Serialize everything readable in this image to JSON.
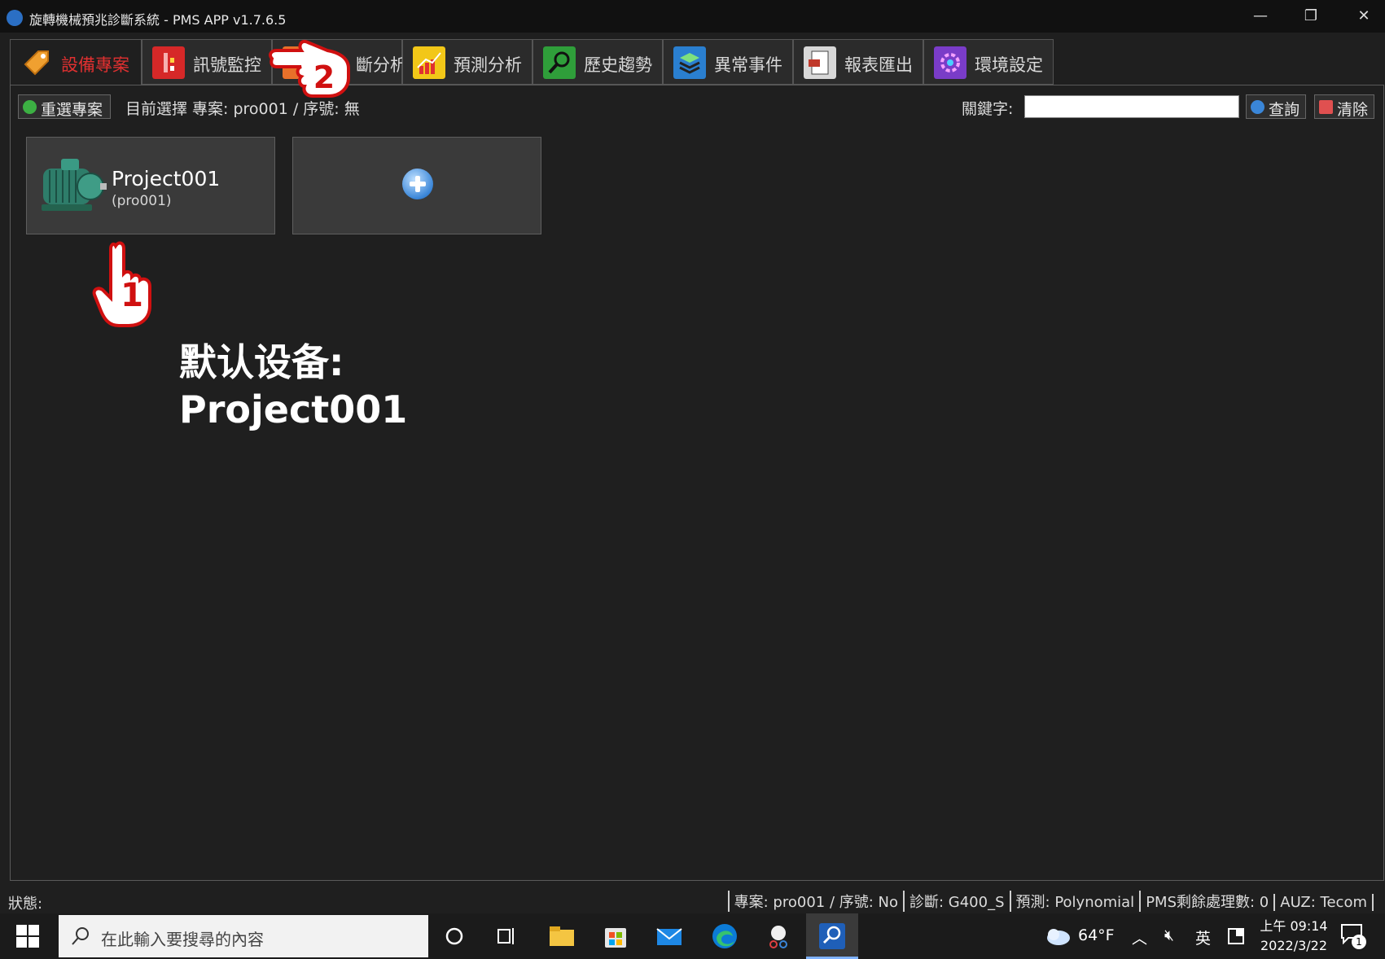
{
  "window": {
    "title": "旋轉機械預兆診斷系統 - PMS APP v1.7.6.5",
    "controls": {
      "minimize": "—",
      "restore": "❐",
      "close": "✕"
    }
  },
  "tabs": [
    {
      "label": "設備專案",
      "icon": "tag-icon",
      "active": true
    },
    {
      "label": "訊號監控",
      "icon": "signal-monitor-icon",
      "active": false
    },
    {
      "label": "斷分析",
      "icon": "diagnosis-analysis-icon",
      "active": false
    },
    {
      "label": "預測分析",
      "icon": "prediction-chart-icon",
      "active": false
    },
    {
      "label": "歷史趨勢",
      "icon": "history-search-icon",
      "active": false
    },
    {
      "label": "異常事件",
      "icon": "layers-icon",
      "active": false
    },
    {
      "label": "報表匯出",
      "icon": "report-export-icon",
      "active": false
    },
    {
      "label": "環境設定",
      "icon": "settings-icon",
      "active": false
    }
  ],
  "toolbar": {
    "reselect_label": "重選專案",
    "current_selection": "目前選擇 專案: pro001 / 序號: 無",
    "keyword_label": "關鍵字:",
    "keyword_value": "",
    "query_label": "查詢",
    "clear_label": "清除"
  },
  "projects": [
    {
      "name": "Project001",
      "id": "(pro001)"
    }
  ],
  "annotations": {
    "step1": "1",
    "step2": "2",
    "note_line1": "默认设备:",
    "note_line2": "Project001"
  },
  "statusbar": {
    "label": "狀態:",
    "segments": [
      "專案: pro001 / 序號: No",
      "診斷: G400_S",
      "預測: Polynomial",
      "PMS剩餘處理數: 0",
      "AUZ: Tecom"
    ]
  },
  "taskbar": {
    "search_placeholder": "在此輸入要搜尋的內容",
    "weather": "64°F",
    "ime": "英",
    "time": "上午 09:14",
    "date": "2022/3/22",
    "notification_count": "1"
  },
  "colors": {
    "active_tab_text": "#e03030",
    "annotation_red": "#e01010"
  }
}
